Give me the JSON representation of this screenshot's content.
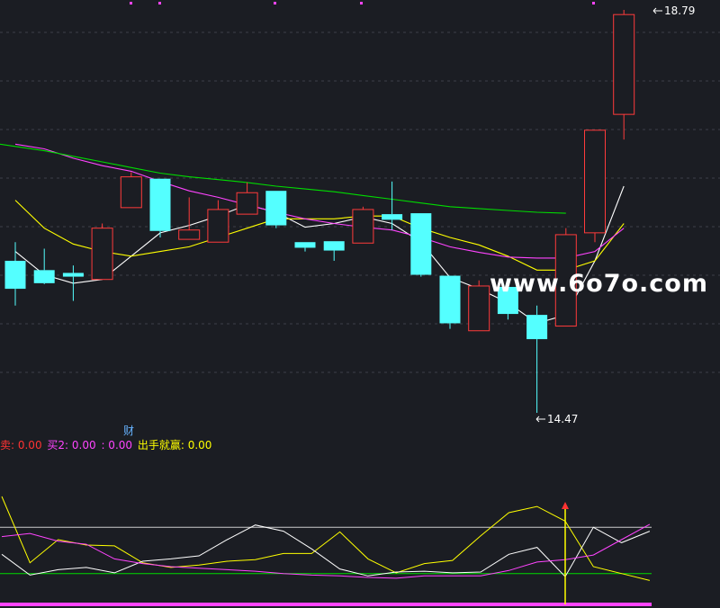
{
  "chart_data": {
    "type": "candlestick",
    "main_panel": {
      "ylim": [
        14.0,
        19.0
      ],
      "high_label": "18.79",
      "low_label": "14.47",
      "marker_label": "财",
      "candles": [
        {
          "o": 16.1,
          "h": 16.3,
          "l": 15.62,
          "c": 15.8
        },
        {
          "o": 16.0,
          "h": 16.23,
          "l": 15.85,
          "c": 15.86
        },
        {
          "o": 15.97,
          "h": 16.05,
          "l": 15.67,
          "c": 15.93
        },
        {
          "o": 15.9,
          "h": 16.5,
          "l": 15.9,
          "c": 16.45
        },
        {
          "o": 16.67,
          "h": 17.05,
          "l": 16.67,
          "c": 17.0
        },
        {
          "o": 16.98,
          "h": 16.98,
          "l": 16.35,
          "c": 16.42
        },
        {
          "o": 16.33,
          "h": 16.78,
          "l": 16.33,
          "c": 16.43
        },
        {
          "o": 16.3,
          "h": 16.75,
          "l": 16.3,
          "c": 16.65
        },
        {
          "o": 16.6,
          "h": 16.94,
          "l": 16.6,
          "c": 16.83
        },
        {
          "o": 16.85,
          "h": 16.85,
          "l": 16.45,
          "c": 16.48
        },
        {
          "o": 16.3,
          "h": 16.3,
          "l": 16.2,
          "c": 16.24
        },
        {
          "o": 16.31,
          "h": 16.31,
          "l": 16.1,
          "c": 16.21
        },
        {
          "o": 16.29,
          "h": 16.68,
          "l": 16.29,
          "c": 16.65
        },
        {
          "o": 16.6,
          "h": 16.95,
          "l": 16.43,
          "c": 16.54
        },
        {
          "o": 16.61,
          "h": 16.61,
          "l": 15.93,
          "c": 15.95
        },
        {
          "o": 15.94,
          "h": 15.94,
          "l": 15.37,
          "c": 15.43
        },
        {
          "o": 15.35,
          "h": 15.89,
          "l": 15.35,
          "c": 15.83
        },
        {
          "o": 15.82,
          "h": 15.82,
          "l": 15.47,
          "c": 15.53
        },
        {
          "o": 15.52,
          "h": 15.62,
          "l": 14.47,
          "c": 15.26
        },
        {
          "o": 15.4,
          "h": 16.45,
          "l": 15.4,
          "c": 16.38
        },
        {
          "o": 16.4,
          "h": 17.5,
          "l": 16.3,
          "c": 17.5
        },
        {
          "o": 17.67,
          "h": 18.79,
          "l": 17.4,
          "c": 18.74
        }
      ],
      "candle_order_note_removed": "",
      "series": [
        {
          "color": "#ffffff",
          "values": [
            16.2,
            15.95,
            15.86,
            15.9,
            16.15,
            16.4,
            16.48,
            16.58,
            16.7,
            16.62,
            16.46,
            16.5,
            16.57,
            16.5,
            16.3,
            15.92,
            15.8,
            15.65,
            15.43,
            15.52,
            16.1,
            16.9
          ]
        },
        {
          "color": "#ffff00",
          "values": [
            16.75,
            16.45,
            16.28,
            16.2,
            16.15,
            16.2,
            16.25,
            16.35,
            16.45,
            16.55,
            16.55,
            16.55,
            16.58,
            16.58,
            16.45,
            16.35,
            16.27,
            16.15,
            16.0,
            16.0,
            16.1,
            16.5
          ]
        },
        {
          "color": "#ff44ff",
          "values": [
            17.35,
            17.3,
            17.2,
            17.12,
            17.06,
            16.95,
            16.85,
            16.78,
            16.7,
            16.62,
            16.55,
            16.5,
            16.46,
            16.43,
            16.35,
            16.25,
            16.19,
            16.14,
            16.13,
            16.13,
            16.2,
            16.45
          ]
        },
        {
          "color": "#00dd00",
          "values": [
            17.35,
            17.28,
            17.22,
            17.16,
            17.1,
            17.04,
            17.0,
            16.97,
            16.94,
            16.9,
            16.87,
            16.84,
            16.8,
            16.76,
            16.72,
            16.68,
            16.66,
            16.64,
            16.62,
            16.61,
            null,
            null
          ]
        }
      ]
    },
    "indicator_panel": {
      "labels": [
        {
          "text": "卖: 0.00",
          "color": "#ff3333"
        },
        {
          "text": "买2: 0.00",
          "color": "#ff44ff"
        },
        {
          "text": ": 0.00",
          "color": "#ff44ff"
        },
        {
          "text": "出手就赢: 0.00",
          "color": "#ffff00"
        }
      ],
      "ylim": [
        -20,
        120
      ],
      "hlines": [
        {
          "value": 80,
          "color": "#cccccc"
        },
        {
          "value": 20,
          "color": "#00dd00"
        },
        {
          "value": -20,
          "color": "#ff44ff"
        }
      ],
      "signal_index": 19,
      "series": [
        {
          "color": "#ffff00",
          "values": [
            120,
            34,
            64,
            57,
            56,
            34,
            28,
            31,
            36,
            38,
            46,
            46,
            74,
            39,
            21,
            33,
            37,
            69,
            99,
            107,
            88,
            29,
            20,
            11
          ]
        },
        {
          "color": "#ffffff",
          "values": [
            45,
            18,
            25,
            28,
            21,
            36,
            39,
            43,
            64,
            83,
            75,
            52,
            26,
            17,
            22,
            23,
            21,
            22,
            45,
            54,
            16,
            80,
            60,
            75
          ]
        },
        {
          "color": "#ff44ff",
          "values": [
            68,
            72,
            62,
            58,
            39,
            33,
            29,
            27,
            25,
            23,
            20,
            18,
            17,
            15,
            14,
            17,
            17,
            17,
            24,
            35,
            38,
            44,
            64,
            84
          ]
        }
      ]
    }
  },
  "watermark": "www.6o7o.com",
  "colors": {
    "background": "#1b1d23",
    "up_candle": "#ff3b3b",
    "down_candle": "#54ffff",
    "grid": "#3c4048"
  }
}
